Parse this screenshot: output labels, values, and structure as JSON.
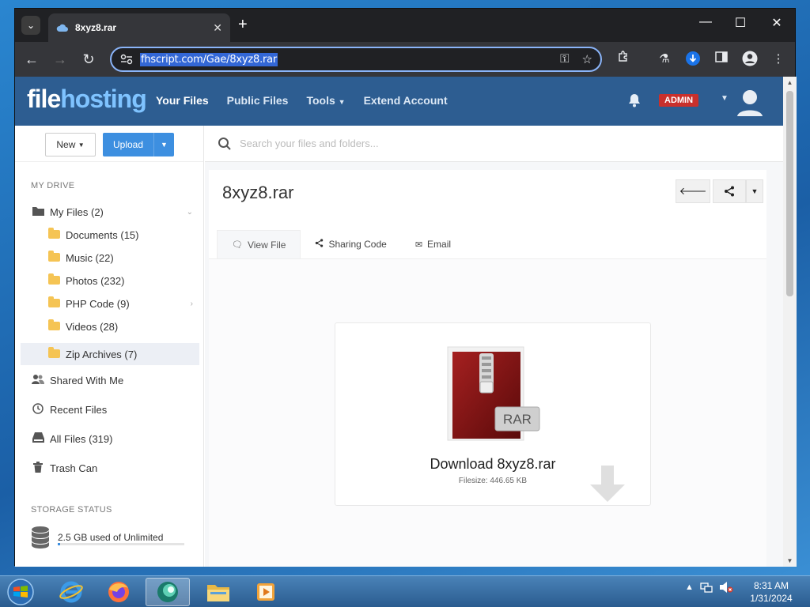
{
  "browser": {
    "tab_title": "8xyz8.rar",
    "url": "fhscript.com/Gae/8xyz8.rar"
  },
  "site": {
    "logo_part1": "file",
    "logo_part2": "hosting",
    "nav": [
      "Your Files",
      "Public Files",
      "Tools",
      "Extend Account"
    ],
    "admin_badge": "ADMIN"
  },
  "sidebar": {
    "new_label": "New",
    "upload_label": "Upload",
    "my_drive_heading": "MY DRIVE",
    "my_files": "My Files (2)",
    "folders": [
      "Documents (15)",
      "Music (22)",
      "Photos (232)",
      "PHP Code (9)",
      "Videos (28)",
      "Zip Archives (7)"
    ],
    "shared": "Shared With Me",
    "recent": "Recent Files",
    "all_files": "All Files (319)",
    "trash": "Trash Can",
    "storage_heading": "STORAGE STATUS",
    "storage_text": "2.5 GB used of Unlimited",
    "storage_used_fraction": 0.02
  },
  "main": {
    "search_placeholder": "Search your files and folders...",
    "file_title": "8xyz8.rar",
    "tabs": [
      "View File",
      "Sharing Code",
      "Email"
    ],
    "file_type_label": "RAR",
    "download_title": "Download 8xyz8.rar",
    "filesize": "Filesize: 446.65 KB"
  },
  "taskbar": {
    "time": "8:31 AM",
    "date": "1/31/2024"
  }
}
